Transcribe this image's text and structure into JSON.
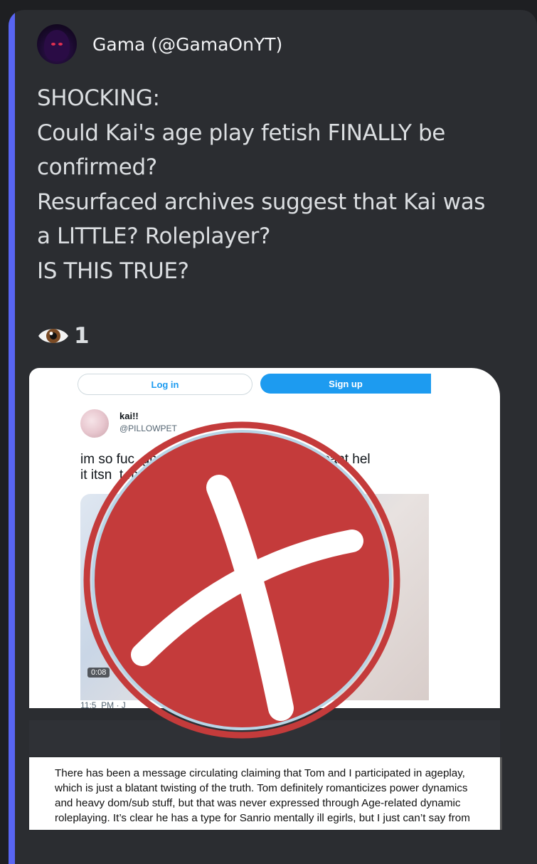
{
  "author": {
    "name": "Gama (@GamaOnYT)"
  },
  "message": {
    "lines": [
      "SHOCKING:",
      "Could Kai's age play fetish FINALLY be",
      "confirmed?",
      "Resurfaced archives suggest that Kai was",
      "a LITTLE? Roleplayer?",
      "IS THIS TRUE?"
    ]
  },
  "reactions": {
    "icon": "eye-icon",
    "view_count": "1"
  },
  "tweet": {
    "login_label": "Log in",
    "signup_label": "Sign up",
    "display_name": "kai!!",
    "handle": "@PILLOWPET",
    "text_line1": "im so fuc  gn sorn            abke cu  epie i cant hel",
    "text_line2": "it itsn  t my f",
    "video_duration": "0:08",
    "timestamp": "11:5  PM · J"
  },
  "document": {
    "lines": [
      "There has been a message circulating claiming that Tom and I participated in ageplay,",
      "which is just a blatant twisting of the truth. Tom definitely romanticizes power dynamics",
      "and heavy dom/sub stuff, but that was never expressed through Age-related dynamic",
      "roleplaying. It’s clear he has a type for Sanrio mentally ill egirls, but I just can’t say from"
    ]
  },
  "colors": {
    "background": "#1e1f22",
    "card": "#2b2d31",
    "accent": "#5865f2",
    "x_red": "#c43b3b",
    "twitter_blue": "#1d9bf0"
  }
}
